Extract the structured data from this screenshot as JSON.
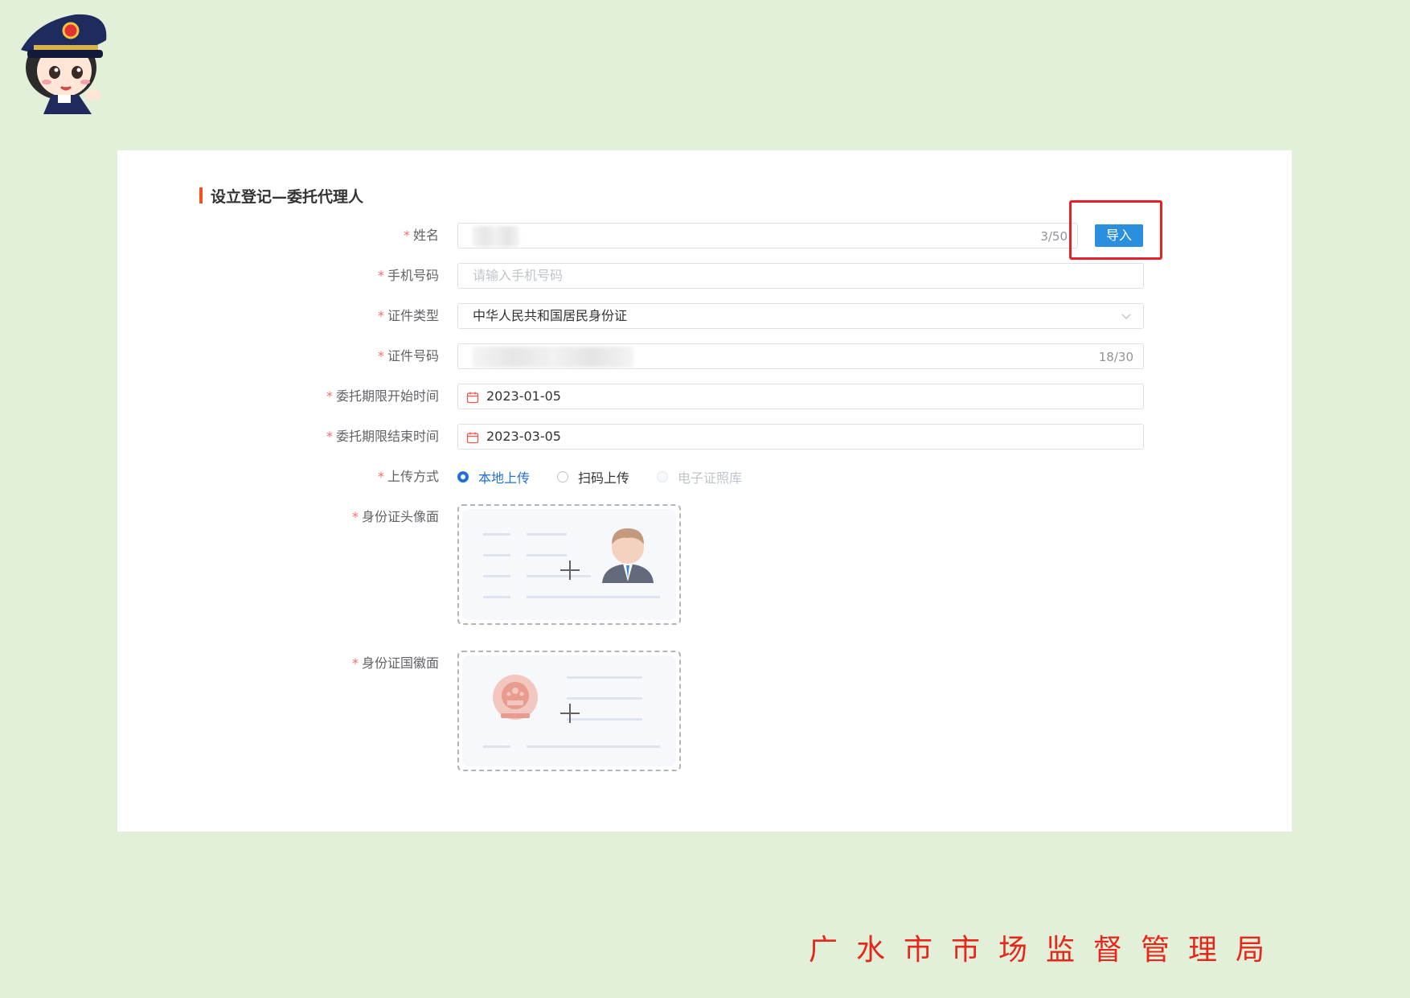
{
  "form": {
    "title": "设立登记—委托代理人",
    "fields": {
      "name": {
        "label": "姓名",
        "required_mark": "*",
        "counter": "3/50"
      },
      "phone": {
        "label": "手机号码",
        "required_mark": "*",
        "placeholder": "请输入手机号码"
      },
      "id_type": {
        "label": "证件类型",
        "required_mark": "*",
        "value": "中华人民共和国居民身份证"
      },
      "id_number": {
        "label": "证件号码",
        "required_mark": "*",
        "counter": "18/30"
      },
      "start_date": {
        "label": "委托期限开始时间",
        "required_mark": "*",
        "value": "2023-01-05"
      },
      "end_date": {
        "label": "委托期限结束时间",
        "required_mark": "*",
        "value": "2023-03-05"
      },
      "upload_method": {
        "label": "上传方式",
        "required_mark": "*",
        "options": [
          {
            "label": "本地上传",
            "state": "checked"
          },
          {
            "label": "扫码上传",
            "state": "unchecked"
          },
          {
            "label": "电子证照库",
            "state": "disabled"
          }
        ]
      },
      "id_front": {
        "label": "身份证头像面",
        "required_mark": "*"
      },
      "id_back": {
        "label": "身份证国徽面",
        "required_mark": "*"
      }
    },
    "import_button": "导入"
  },
  "footer": {
    "text": "广水市市场监督管理局"
  },
  "colors": {
    "background": "#e2efd9",
    "primary": "#2b8fdf",
    "radio_checked": "#1f6fd6",
    "required": "#f56c6c",
    "title_bar": "#f4511e",
    "highlight": "#e8202a",
    "footer_text": "#e6281c"
  }
}
